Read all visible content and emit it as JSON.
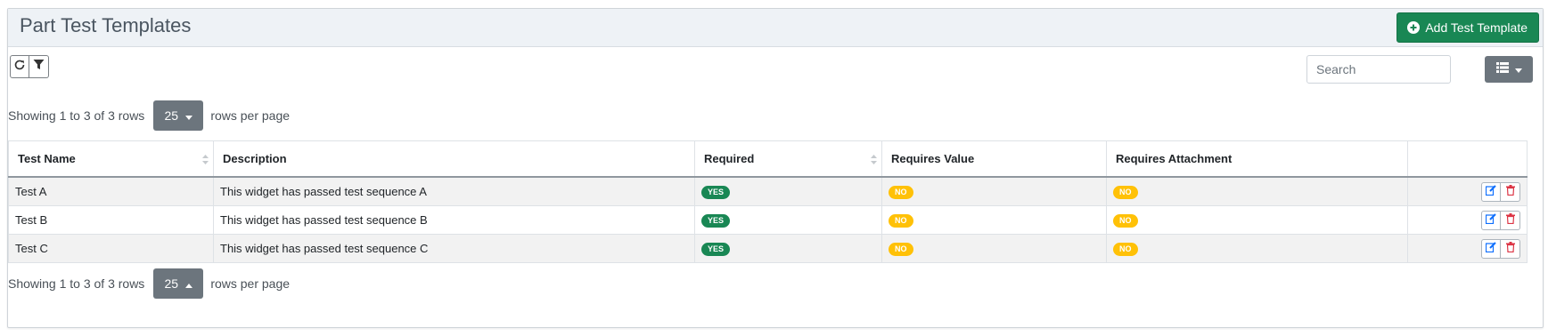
{
  "header": {
    "title": "Part Test Templates",
    "add_button_label": "Add Test Template"
  },
  "toolbar": {
    "refresh_icon": "refresh-icon",
    "filter_icon": "filter-icon",
    "search_placeholder": "Search",
    "view_icon": "list-view-icon"
  },
  "pagination": {
    "showing_text": "Showing 1 to 3 of 3 rows",
    "page_size": "25",
    "rows_per_page_label": "rows per page"
  },
  "table": {
    "columns": [
      "Test Name",
      "Description",
      "Required",
      "Requires Value",
      "Requires Attachment",
      ""
    ],
    "rows": [
      {
        "name": "Test A",
        "description": "This widget has passed test sequence A",
        "required": "YES",
        "requires_value": "NO",
        "requires_attachment": "NO"
      },
      {
        "name": "Test B",
        "description": "This widget has passed test sequence B",
        "required": "YES",
        "requires_value": "NO",
        "requires_attachment": "NO"
      },
      {
        "name": "Test C",
        "description": "This widget has passed test sequence C",
        "required": "YES",
        "requires_value": "NO",
        "requires_attachment": "NO"
      }
    ]
  },
  "colors": {
    "success": "#198754",
    "warning": "#ffc107",
    "secondary": "#6c757d"
  }
}
